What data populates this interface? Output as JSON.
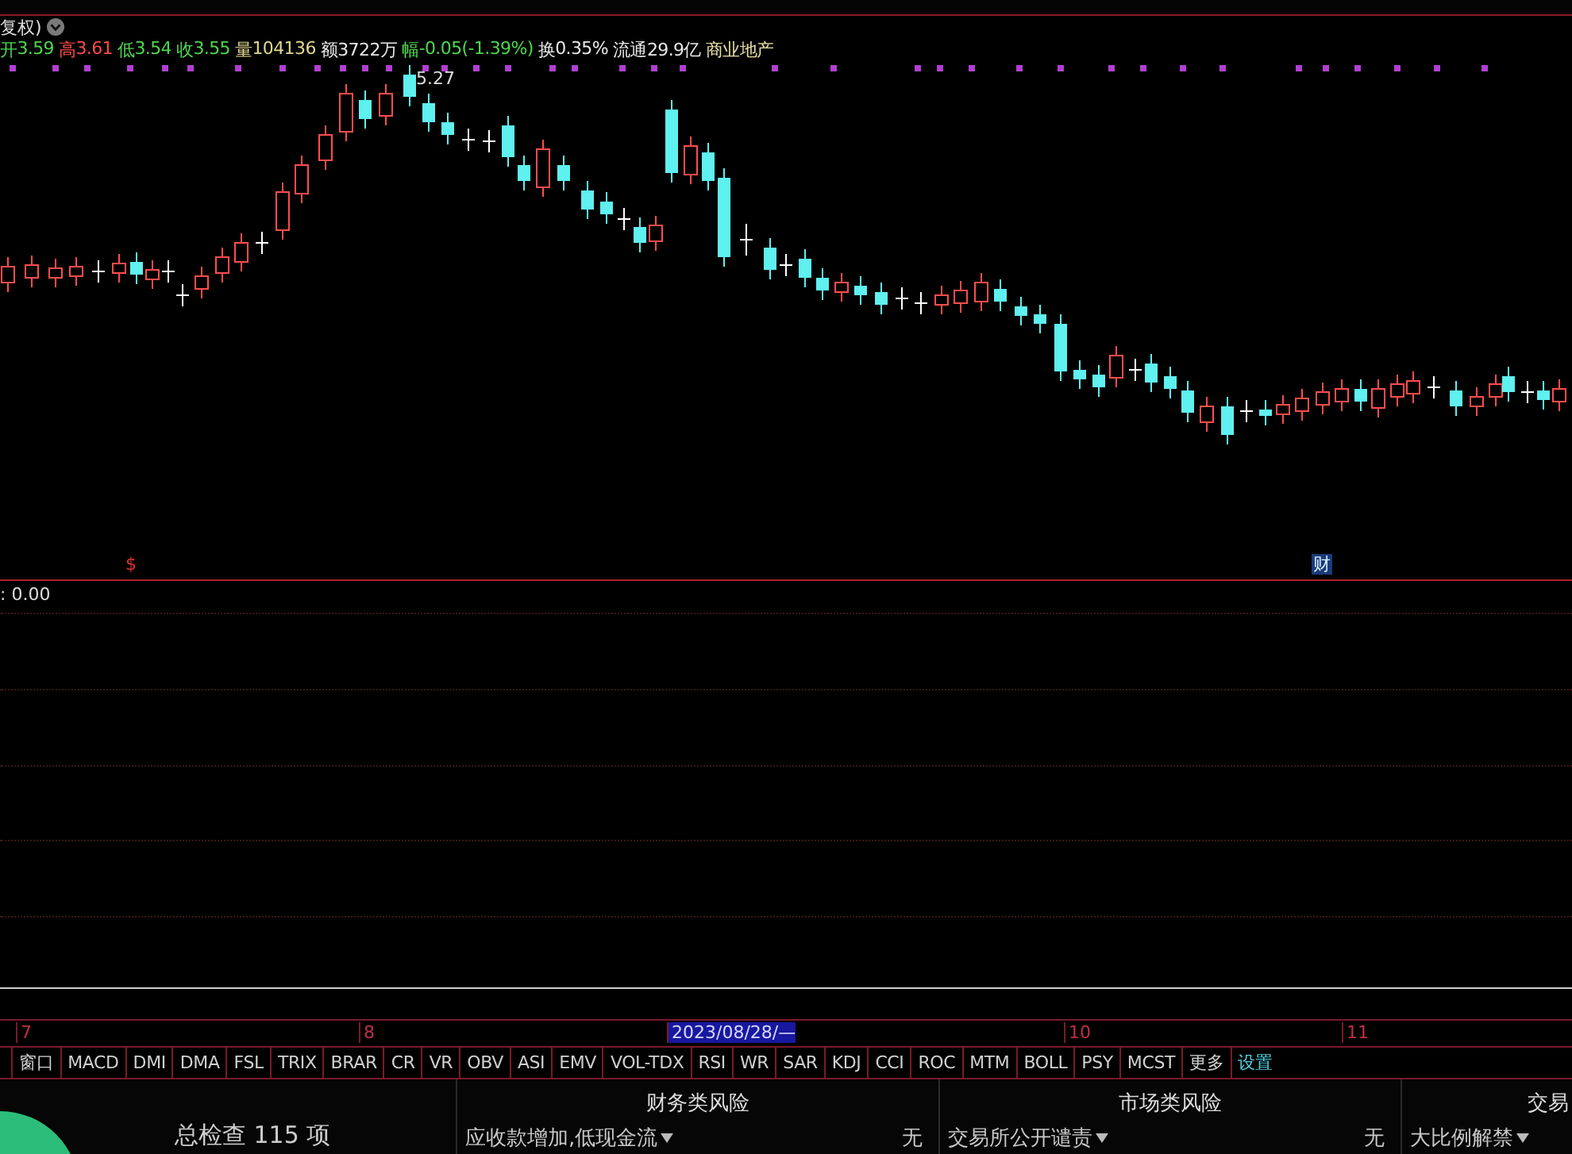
{
  "title_bar": {
    "adjust_label": "复权)"
  },
  "quote": [
    {
      "label": "开",
      "value": "3.59",
      "color": "#4fd64f"
    },
    {
      "label": "高",
      "value": "3.61",
      "color": "#ff4a4a"
    },
    {
      "label": "低",
      "value": "3.54",
      "color": "#4fd64f"
    },
    {
      "label": "收",
      "value": "3.55",
      "color": "#4fd64f"
    },
    {
      "label": "量",
      "value": "104136",
      "color": "#e0d890"
    },
    {
      "label": "额",
      "value": "3722万",
      "color": "#e8e8e8"
    },
    {
      "label": "幅",
      "value": "-0.05(-1.39%)",
      "color": "#4fd64f"
    },
    {
      "label": "换",
      "value": "0.35%",
      "color": "#e8e8e8"
    },
    {
      "label": "流通",
      "value": "29.9亿",
      "color": "#e8e8e8"
    },
    {
      "label": "商业地产",
      "color": "#e8e0a8"
    }
  ],
  "chart": {
    "high_label": "5.27"
  },
  "event_markers": [
    {
      "text": "$",
      "kind": "dividend"
    },
    {
      "text": "财",
      "kind": "finance"
    }
  ],
  "indicator_label": ": 0.00",
  "date_axis": [
    {
      "text": "7",
      "selected": false
    },
    {
      "text": "8",
      "selected": false
    },
    {
      "text": "2023/08/28/—",
      "selected": true
    },
    {
      "text": "10",
      "selected": false
    },
    {
      "text": "11",
      "selected": false
    }
  ],
  "tabs": [
    {
      "label": "窗口",
      "kind": "indicator"
    },
    {
      "label": "MACD",
      "kind": "indicator"
    },
    {
      "label": "DMI",
      "kind": "indicator"
    },
    {
      "label": "DMA",
      "kind": "indicator"
    },
    {
      "label": "FSL",
      "kind": "indicator"
    },
    {
      "label": "TRIX",
      "kind": "indicator"
    },
    {
      "label": "BRAR",
      "kind": "indicator"
    },
    {
      "label": "CR",
      "kind": "indicator"
    },
    {
      "label": "VR",
      "kind": "indicator"
    },
    {
      "label": "OBV",
      "kind": "indicator"
    },
    {
      "label": "ASI",
      "kind": "indicator"
    },
    {
      "label": "EMV",
      "kind": "indicator"
    },
    {
      "label": "VOL-TDX",
      "kind": "indicator"
    },
    {
      "label": "RSI",
      "kind": "indicator"
    },
    {
      "label": "WR",
      "kind": "indicator"
    },
    {
      "label": "SAR",
      "kind": "indicator"
    },
    {
      "label": "KDJ",
      "kind": "indicator"
    },
    {
      "label": "CCI",
      "kind": "indicator"
    },
    {
      "label": "ROC",
      "kind": "indicator"
    },
    {
      "label": "MTM",
      "kind": "indicator"
    },
    {
      "label": "BOLL",
      "kind": "indicator"
    },
    {
      "label": "PSY",
      "kind": "indicator"
    },
    {
      "label": "MCST",
      "kind": "indicator"
    },
    {
      "label": "更多",
      "kind": "indicator"
    },
    {
      "label": "设置",
      "kind": "settings"
    }
  ],
  "risk_panel": {
    "summary": "总检查 115 项",
    "columns": [
      {
        "title": "财务类风险",
        "item": "应收款增加,低现金流",
        "result": "无"
      },
      {
        "title": "市场类风险",
        "item": "交易所公开谴责",
        "result": "无"
      },
      {
        "title": "交易",
        "item": "大比例解禁"
      }
    ]
  }
}
